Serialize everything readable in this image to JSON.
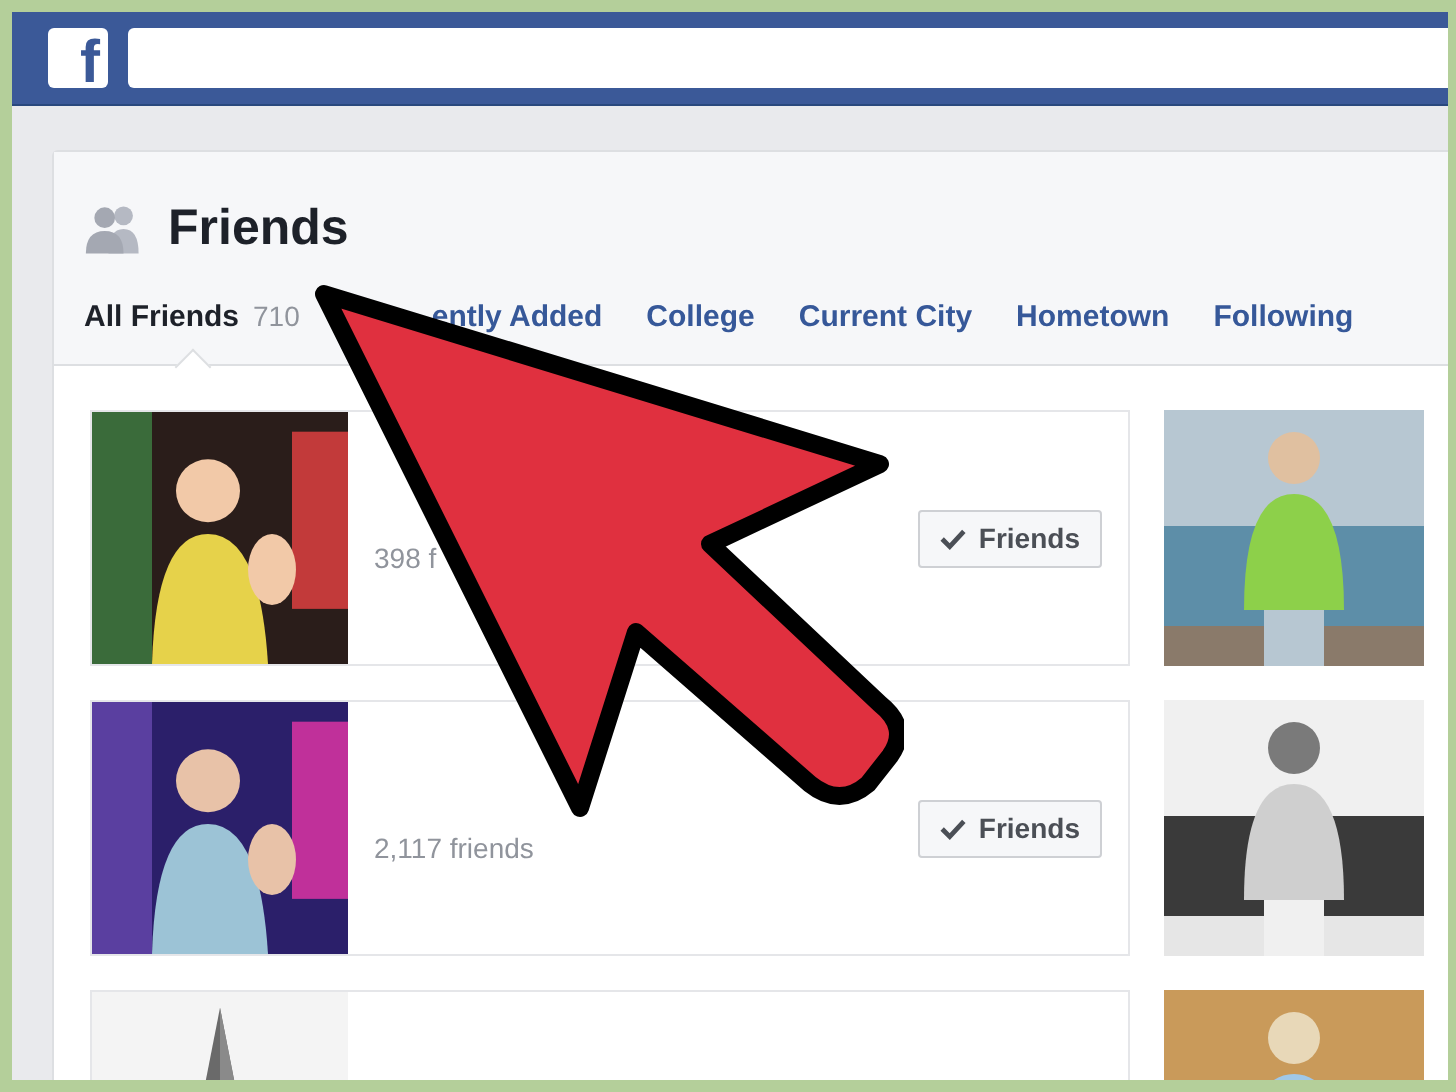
{
  "header": {
    "logo": "f"
  },
  "section": {
    "title": "Friends",
    "tabs": [
      {
        "label": "All Friends",
        "count": "710",
        "selected": true
      },
      {
        "label": "ently Added",
        "selected": false
      },
      {
        "label": "College",
        "selected": false
      },
      {
        "label": "Current City",
        "selected": false
      },
      {
        "label": "Hometown",
        "selected": false
      },
      {
        "label": "Following",
        "selected": false
      }
    ]
  },
  "friends": [
    {
      "kind": "friend",
      "count": "398 f",
      "button": "Friends"
    },
    {
      "kind": "friend",
      "count": "2,117 friends",
      "button": "Friends"
    },
    {
      "kind": "picture"
    }
  ],
  "side_photos": [
    {
      "kind": "picture"
    },
    {
      "kind": "picture"
    },
    {
      "kind": "picture"
    }
  ]
}
